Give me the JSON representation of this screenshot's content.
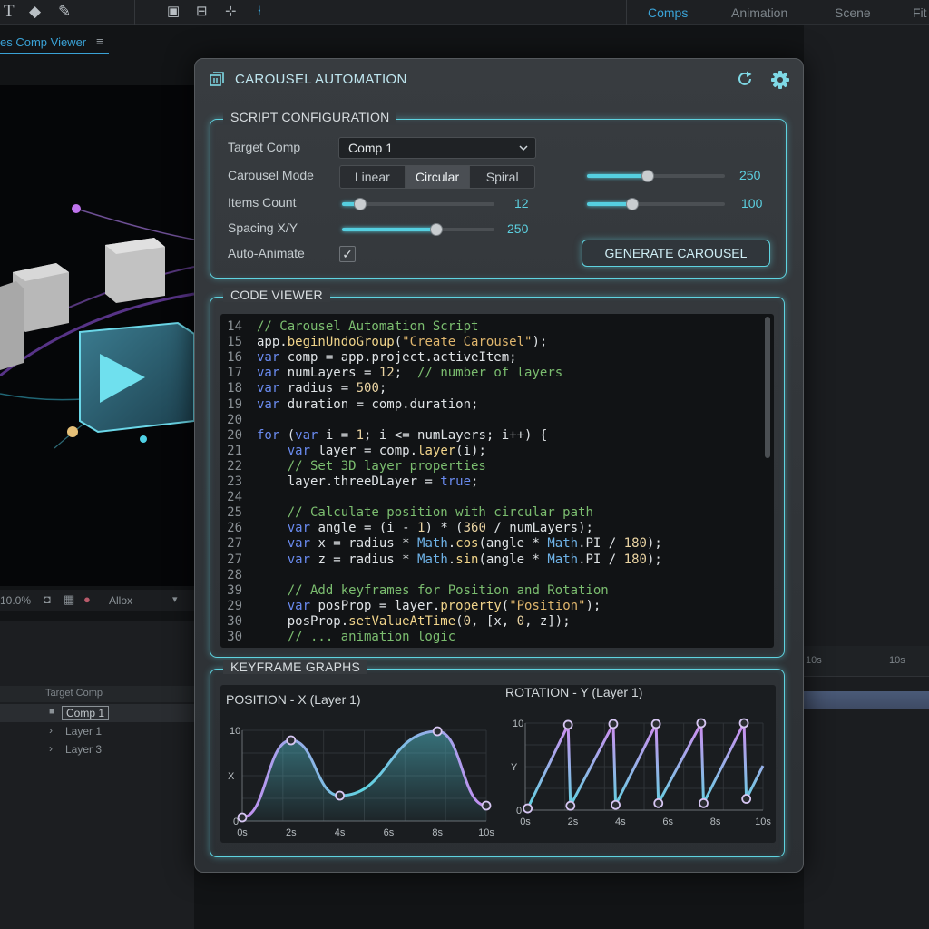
{
  "workspace_tabs": [
    "Comps",
    "Animation",
    "Scene",
    "Fit"
  ],
  "viewer": {
    "tab_label": "es Comp Viewer",
    "zoom": "10.0%",
    "view_label": "Allox"
  },
  "left_panel": {
    "header": "Target Comp",
    "rows": [
      "Comp 1",
      "Layer 1",
      "Layer 3"
    ]
  },
  "timeline": {
    "ticks": [
      "10s",
      "10s"
    ]
  },
  "panel": {
    "title": "CAROUSEL AUTOMATION",
    "config": {
      "title": "SCRIPT CONFIGURATION",
      "target_comp_label": "Target Comp",
      "target_comp_value": "Comp 1",
      "carousel_mode_label": "Carousel Mode",
      "modes": [
        "Linear",
        "Circular",
        "Spiral"
      ],
      "selected_mode": "Circular",
      "items_count_label": "Items Count",
      "items_count_value": "12",
      "spacing_label": "Spacing X/Y",
      "spacing_value": "250",
      "auto_animate_label": "Auto-Animate",
      "auto_animate_checked": true,
      "right_slider_1_value": "250",
      "right_slider_2_value": "100",
      "generate_label": "GENERATE CAROUSEL",
      "items_count_fraction": 0.12,
      "spacing_fraction": 0.62,
      "right_slider_1_fraction": 0.44,
      "right_slider_2_fraction": 0.33
    },
    "code": {
      "title": "CODE VIEWER",
      "lines": [
        {
          "n": "14",
          "t": "// Carousel Automation Script"
        },
        {
          "n": "15",
          "t": "app.beginUndoGroup(\"Create Carousel\");"
        },
        {
          "n": "16",
          "t": "var comp = app.project.activeItem;"
        },
        {
          "n": "17",
          "t": "var numLayers = 12;  // number of layers"
        },
        {
          "n": "18",
          "t": "var radius = 500;"
        },
        {
          "n": "19",
          "t": "var duration = comp.duration;"
        },
        {
          "n": "20",
          "t": ""
        },
        {
          "n": "20",
          "t": "for (var i = 1; i <= numLayers; i++) {"
        },
        {
          "n": "21",
          "t": "    var layer = comp.layer(i);"
        },
        {
          "n": "22",
          "t": "    // Set 3D layer properties"
        },
        {
          "n": "23",
          "t": "    layer.threeDLayer = true;"
        },
        {
          "n": "24",
          "t": ""
        },
        {
          "n": "25",
          "t": "    // Calculate position with circular path"
        },
        {
          "n": "26",
          "t": "    var angle = (i - 1) * (360 / numLayers);"
        },
        {
          "n": "27",
          "t": "    var x = radius * Math.cos(angle * Math.PI / 180);"
        },
        {
          "n": "27",
          "t": "    var z = radius * Math.sin(angle * Math.PI / 180);"
        },
        {
          "n": "28",
          "t": ""
        },
        {
          "n": "39",
          "t": "    // Add keyframes for Position and Rotation"
        },
        {
          "n": "29",
          "t": "    var posProp = layer.property(\"Position\");"
        },
        {
          "n": "30",
          "t": "    posProp.setValueAtTime(0, [x, 0, z]);"
        },
        {
          "n": "30",
          "t": "    // ... animation logic"
        }
      ]
    },
    "graphs": {
      "title": "KEYFRAME GRAPHS",
      "position": {
        "title": "POSITION - X (Layer 1)",
        "y_label": "X",
        "y_ticks": [
          "10",
          "0"
        ],
        "x_ticks": [
          "0s",
          "2s",
          "4s",
          "6s",
          "8s",
          "10s"
        ],
        "keyframes": [
          [
            0,
            0.4
          ],
          [
            2,
            8.9
          ],
          [
            4,
            2.8
          ],
          [
            8,
            9.9
          ],
          [
            10,
            1.7
          ]
        ]
      },
      "rotation": {
        "title": "ROTATION - Y (Layer 1)",
        "y_label": "Y",
        "y_ticks": [
          "10",
          "0"
        ],
        "x_ticks": [
          "0s",
          "2s",
          "4s",
          "6s",
          "8s",
          "10s"
        ],
        "keyframes": [
          [
            0.1,
            0.2
          ],
          [
            1.8,
            9.8
          ],
          [
            1.9,
            0.5
          ],
          [
            3.7,
            9.9
          ],
          [
            3.8,
            0.6
          ],
          [
            5.5,
            9.9
          ],
          [
            5.6,
            0.8
          ],
          [
            7.4,
            10
          ],
          [
            7.5,
            0.8
          ],
          [
            9.2,
            10
          ],
          [
            9.3,
            1.3
          ],
          [
            10,
            5.1
          ]
        ],
        "markers": [
          [
            0.1,
            0.2
          ],
          [
            1.8,
            9.8
          ],
          [
            1.9,
            0.5
          ],
          [
            3.7,
            9.9
          ],
          [
            3.8,
            0.6
          ],
          [
            5.5,
            9.9
          ],
          [
            5.6,
            0.8
          ],
          [
            7.4,
            10
          ],
          [
            7.5,
            0.8
          ],
          [
            9.2,
            10
          ],
          [
            9.3,
            1.3
          ]
        ]
      }
    }
  },
  "colors": {
    "accent": "#5fd3e0",
    "curve_pink": "#c58cf0",
    "link_blue": "#3aa2d6"
  }
}
